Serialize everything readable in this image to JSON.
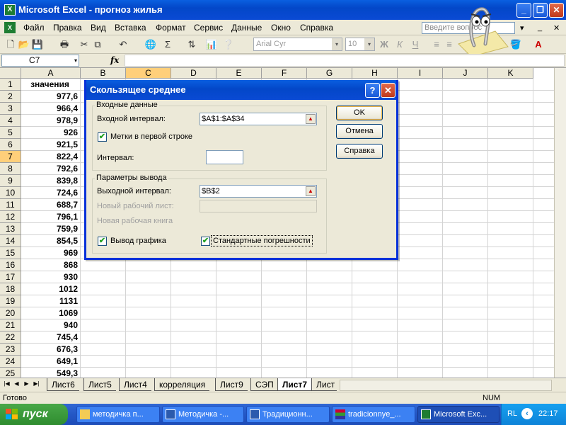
{
  "window": {
    "title": "Microsoft Excel - прогноз жилья",
    "min": "_",
    "max": "❐",
    "close": "✕"
  },
  "menu": {
    "items": [
      "Файл",
      "Правка",
      "Вид",
      "Вставка",
      "Формат",
      "Сервис",
      "Данные",
      "Окно",
      "Справка"
    ],
    "help_placeholder": "Введите вопрос",
    "help_dd": "▾",
    "mdi_min": "_",
    "mdi_close": "✕"
  },
  "toolbar": {
    "font_name": "Arial Cyr",
    "font_size": "10",
    "dd": "▾",
    "sigma": "Σ",
    "fx_label": "fx",
    "bold": "Ж",
    "italic": "К",
    "underline": "Ч"
  },
  "formula_bar": {
    "name_box": "C7",
    "name_dd": "▾",
    "fx": "fx",
    "value": ""
  },
  "grid": {
    "columns": [
      "A",
      "B",
      "C",
      "D",
      "E",
      "F",
      "G",
      "H",
      "I",
      "J",
      "K"
    ],
    "selected_column": "C",
    "selected_row": "7",
    "rows": [
      "1",
      "2",
      "3",
      "4",
      "5",
      "6",
      "7",
      "8",
      "9",
      "10",
      "11",
      "12",
      "13",
      "14",
      "15",
      "16",
      "17",
      "18",
      "19",
      "20",
      "21",
      "22",
      "23",
      "24",
      "25"
    ],
    "col_a": [
      "значения",
      "977,6",
      "966,4",
      "978,9",
      "926",
      "921,5",
      "822,4",
      "792,6",
      "839,8",
      "724,6",
      "688,7",
      "796,1",
      "759,9",
      "854,5",
      "969",
      "868",
      "930",
      "1012",
      "1131",
      "1069",
      "940",
      "745,4",
      "676,3",
      "649,1",
      "549,3"
    ]
  },
  "sheets": {
    "nav": [
      "|◀",
      "◀",
      "▶",
      "▶|"
    ],
    "tabs": [
      "Лист6",
      "Лист5",
      "Лист4",
      "корреляция",
      "Лист9",
      "СЭП",
      "Лист7",
      "Лист"
    ],
    "active": "Лист7"
  },
  "status": {
    "ready": "Готово",
    "num": "NUM"
  },
  "dialog": {
    "title": "Скользящее среднее",
    "help": "?",
    "close": "✕",
    "input_group": "Входные данные",
    "input_range_label": "Входной интервал:",
    "input_range_value": "$A$1:$A$34",
    "labels_first_row": "Метки в первой строке",
    "labels_checked": "✔",
    "interval_label": "Интервал:",
    "interval_value": "",
    "output_group": "Параметры вывода",
    "output_range_label": "Выходной интервал:",
    "output_range_value": "$B$2",
    "new_sheet_label": "Новый рабочий лист:",
    "new_book_label": "Новая рабочая книга",
    "chart_output_label": "Вывод графика",
    "chart_checked": "✔",
    "std_errors_label": "Стандартные погрешности",
    "std_checked": "✔",
    "ok": "OK",
    "cancel": "Отмена",
    "help_btn": "Справка",
    "collapse_glyph": "▲"
  },
  "taskbar": {
    "start": "пуск",
    "tasks": [
      "методичка п...",
      "Методичка -...",
      "Традиционн...",
      "tradicionnye_...",
      "Microsoft Exc..."
    ],
    "lang": "RL",
    "chevron": "‹",
    "clock": "22:17"
  }
}
